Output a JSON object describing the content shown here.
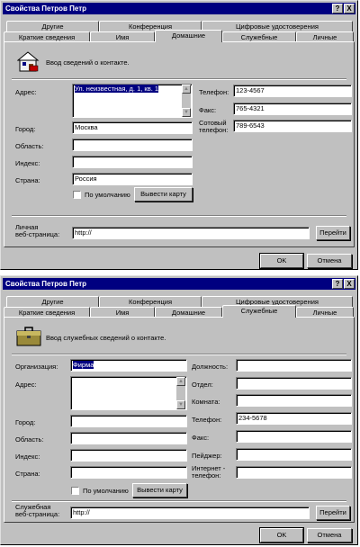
{
  "window_title": "Свойства Петров Петр",
  "title_buttons": {
    "help": "?",
    "close": "X"
  },
  "tabs_back": [
    "Другие",
    "Конференция",
    "Цифровые удостоверения"
  ],
  "tabs_front": [
    "Краткие сведения",
    "Имя",
    "Домашние",
    "Служебные",
    "Личные"
  ],
  "home": {
    "active_tab": "Домашние",
    "caption": "Ввод сведений о контакте.",
    "address_label": "Адрес:",
    "address_value": "Ул. неизвестная, д. 1, кв. 1",
    "city_label": "Город:",
    "city_value": "Москва",
    "region_label": "Область:",
    "region_value": "",
    "zip_label": "Индекс:",
    "zip_value": "",
    "country_label": "Страна:",
    "country_value": "Россия",
    "default_label": "По умолчанию",
    "default_checked": false,
    "map_button": "Вывести карту",
    "phone_label": "Телефон:",
    "phone_value": "123-4567",
    "fax_label": "Факс:",
    "fax_value": "765-4321",
    "mobile_label_1": "Сотовый",
    "mobile_label_2": "телефон:",
    "mobile_value": "789-6543",
    "web_label_1": "Личная",
    "web_label_2": "веб-страница:",
    "web_value": "http://",
    "go_button": "Перейти",
    "ok_button": "OK",
    "cancel_button": "Отмена"
  },
  "work": {
    "active_tab": "Служебные",
    "caption": "Ввод служебных сведений о контакте.",
    "org_label": "Организация:",
    "org_value": "Фирма",
    "address_label": "Адрес:",
    "address_value": "",
    "city_label": "Город:",
    "city_value": "",
    "region_label": "Область:",
    "region_value": "",
    "zip_label": "Индекс:",
    "zip_value": "",
    "country_label": "Страна:",
    "country_value": "",
    "default_label": "По умолчанию",
    "default_checked": false,
    "map_button": "Вывести карту",
    "position_label": "Должность:",
    "position_value": "",
    "dept_label": "Отдел:",
    "dept_value": "",
    "room_label": "Комната:",
    "room_value": "",
    "phone_label": "Телефон:",
    "phone_value": "234-5678",
    "fax_label": "Факс:",
    "fax_value": "",
    "pager_label": "Пейджер:",
    "pager_value": "",
    "ip_label_1": "Интернет -",
    "ip_label_2": "телефон:",
    "ip_value": "",
    "web_label_1": "Служебная",
    "web_label_2": "веб-страница:",
    "web_value": "http://",
    "go_button": "Перейти",
    "ok_button": "OK",
    "cancel_button": "Отмена"
  }
}
